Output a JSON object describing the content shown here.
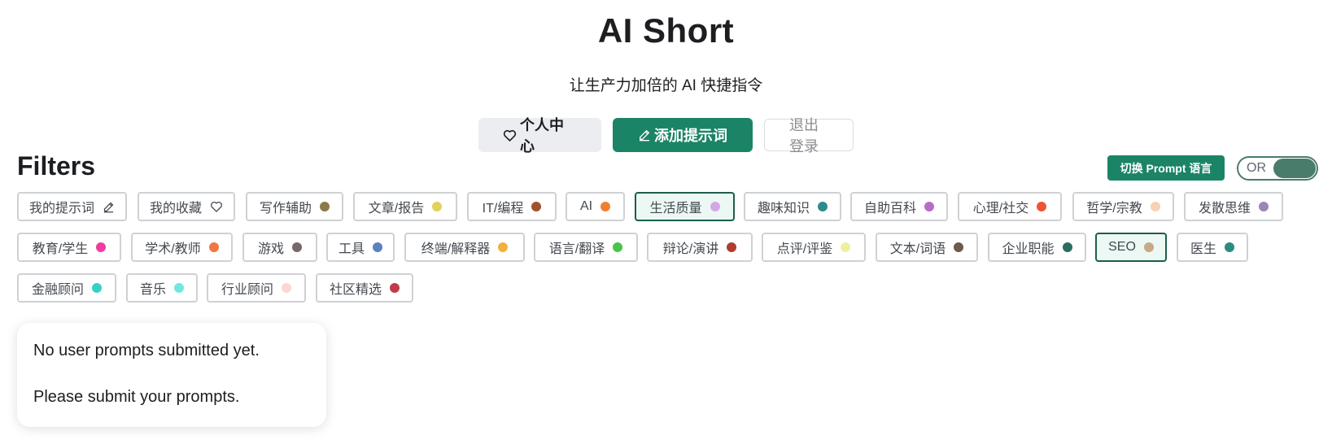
{
  "header": {
    "title": "AI Short",
    "subtitle": "让生产力加倍的 AI 快捷指令",
    "profile_label": "个人中心",
    "add_label": "添加提示词",
    "logout_label": "退出登录"
  },
  "filters": {
    "title": "Filters",
    "lang_button": "切换 Prompt 语言",
    "toggle_label": "OR",
    "tags": [
      {
        "label": "我的提示词",
        "icon": "pencil-icon"
      },
      {
        "label": "我的收藏",
        "icon": "heart-icon"
      },
      {
        "label": "写作辅助",
        "color": "#8c7a48"
      },
      {
        "label": "文章/报告",
        "color": "#e0d25a"
      },
      {
        "label": "IT/编程",
        "color": "#a0522d"
      },
      {
        "label": "AI",
        "color": "#f08030"
      },
      {
        "label": "生活质量",
        "color": "#d5a6e6",
        "active": true
      },
      {
        "label": "趣味知识",
        "color": "#2b8c8c"
      },
      {
        "label": "自助百科",
        "color": "#b86bc8"
      },
      {
        "label": "心理/社交",
        "color": "#ee5533"
      },
      {
        "label": "哲学/宗教",
        "color": "#f9cfb5"
      },
      {
        "label": "发散思维",
        "color": "#9b86b5"
      },
      {
        "label": "教育/学生",
        "color": "#f03ca0"
      },
      {
        "label": "学术/教师",
        "color": "#f07840"
      },
      {
        "label": "游戏",
        "color": "#786868"
      },
      {
        "label": "工具",
        "color": "#5c80c0"
      },
      {
        "label": "终端/解释器",
        "color": "#f4b03c"
      },
      {
        "label": "语言/翻译",
        "color": "#48c448"
      },
      {
        "label": "辩论/演讲",
        "color": "#b03c30"
      },
      {
        "label": "点评/评鉴",
        "color": "#eef0a0"
      },
      {
        "label": "文本/词语",
        "color": "#6e5a4a"
      },
      {
        "label": "企业职能",
        "color": "#2b6e60"
      },
      {
        "label": "SEO",
        "color": "#c8a888",
        "active": true
      },
      {
        "label": "医生",
        "color": "#2b8c80"
      },
      {
        "label": "金融顾问",
        "color": "#36d0c8"
      },
      {
        "label": "音乐",
        "color": "#74e6e0"
      },
      {
        "label": "行业顾问",
        "color": "#fcd6d0"
      },
      {
        "label": "社区精选",
        "color": "#c03c48"
      }
    ]
  },
  "empty_state": {
    "line1": "No user prompts submitted yet.",
    "line2": "Please submit your prompts."
  }
}
